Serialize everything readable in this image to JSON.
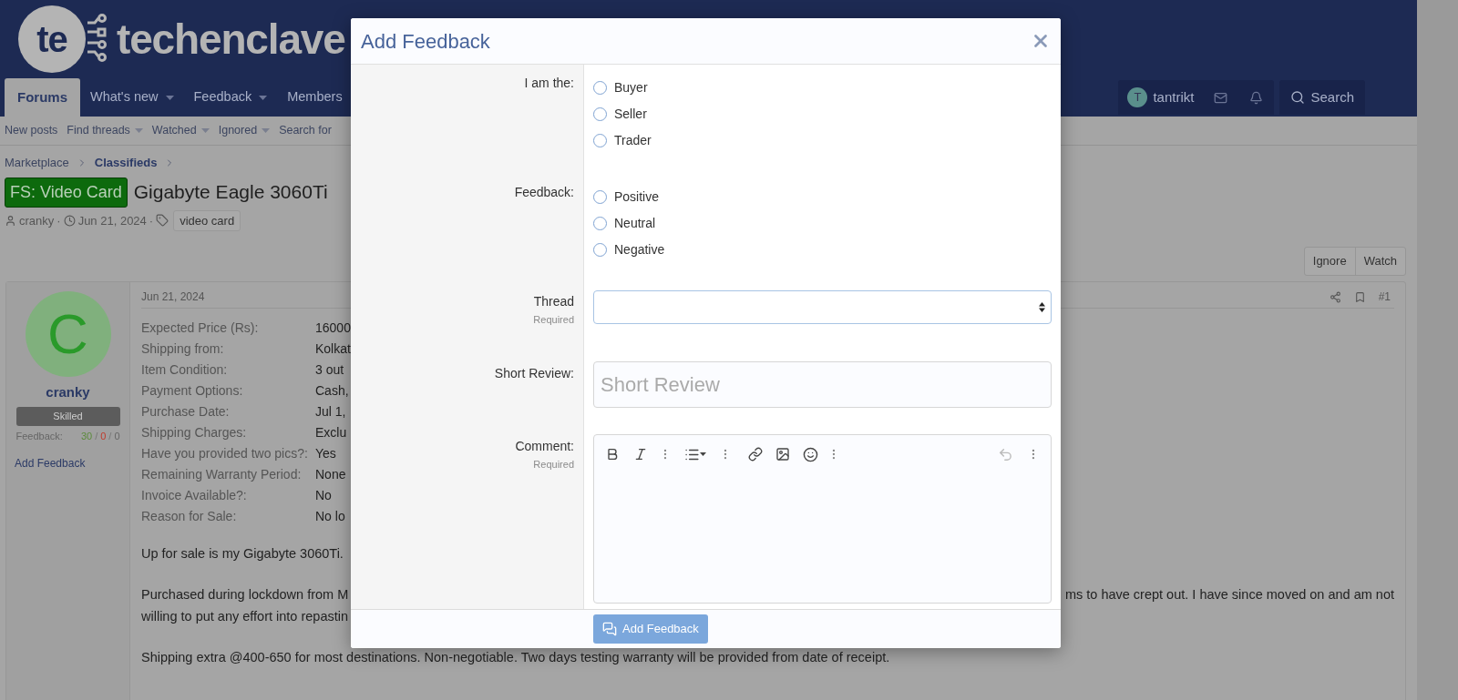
{
  "header": {
    "logo_badge": "te",
    "logo_wordmark": "techenclave",
    "nav_tabs": [
      {
        "label": "Forums",
        "selected": true,
        "has_menu": false
      },
      {
        "label": "What's new",
        "selected": false,
        "has_menu": true
      },
      {
        "label": "Feedback",
        "selected": false,
        "has_menu": true
      },
      {
        "label": "Members",
        "selected": false,
        "has_menu": false
      }
    ],
    "user": {
      "initial": "T",
      "name": "tantrikt"
    },
    "search": "Search"
  },
  "sub_nav": [
    {
      "label": "New posts",
      "has_menu": false
    },
    {
      "label": "Find threads",
      "has_menu": true
    },
    {
      "label": "Watched",
      "has_menu": true
    },
    {
      "label": "Ignored",
      "has_menu": true
    },
    {
      "label": "Search for",
      "has_menu": false
    }
  ],
  "breadcrumb": [
    {
      "label": "Marketplace",
      "current": false
    },
    {
      "label": "Classifieds",
      "current": true
    }
  ],
  "thread": {
    "prefix": "FS: Video Card",
    "title": "Gigabyte Eagle 3060Ti",
    "author": "cranky",
    "separator": "·",
    "date": "Jun 21, 2024",
    "tags": [
      "video card"
    ]
  },
  "actions": [
    "Ignore",
    "Watch"
  ],
  "post": {
    "user": {
      "initial": "C",
      "name": "cranky",
      "rank": "Skilled",
      "feedback_label": "Feedback:",
      "positive": "30",
      "separator": "/",
      "negative": "0",
      "neutral": "0",
      "add_feedback": "Add Feedback"
    },
    "date": "Jun 21, 2024",
    "number": "#1",
    "fields": [
      {
        "label": "Expected Price (Rs):",
        "value": "16000"
      },
      {
        "label": "Shipping from:",
        "value": "Kolkat"
      },
      {
        "label": "Item Condition:",
        "value": "3 out"
      },
      {
        "label": "Payment Options:",
        "value": "Cash,"
      },
      {
        "label": "Purchase Date:",
        "value": "Jul 1,"
      },
      {
        "label": "Shipping Charges:",
        "value": "Exclu"
      },
      {
        "label": "Have you provided two pics?:",
        "value": "Yes"
      },
      {
        "label": "Remaining Warranty Period:",
        "value": "None"
      },
      {
        "label": "Invoice Available?:",
        "value": "No"
      },
      {
        "label": "Reason for Sale:",
        "value": "No lo"
      }
    ],
    "paragraphs": [
      {
        "lines": [
          {
            "left": "Up for sale is my Gigabyte 3060Ti."
          }
        ]
      },
      {
        "lines": [
          {
            "left": "Purchased during lockdown from M",
            "right": "ms to have crept out. I have since moved on and am not"
          },
          {
            "left": "willing to put any effort into repastin"
          }
        ]
      },
      {
        "lines": [
          {
            "left": "Shipping extra @400-650 for most destinations. Non-negotiable. Two days testing warranty will be provided from date of receipt."
          }
        ]
      }
    ]
  },
  "modal": {
    "title": "Add Feedback",
    "fields": [
      {
        "kind": "radio",
        "label": "I am the:",
        "options": [
          {
            "label": "Buyer",
            "selected": false
          },
          {
            "label": "Seller",
            "selected": false
          },
          {
            "label": "Trader",
            "selected": false
          }
        ]
      },
      {
        "kind": "radio",
        "label": "Feedback:",
        "options": [
          {
            "label": "Positive",
            "selected": false
          },
          {
            "label": "Neutral",
            "selected": false
          },
          {
            "label": "Negative",
            "selected": false
          }
        ]
      },
      {
        "kind": "select",
        "label": "Thread",
        "hint": "Required"
      },
      {
        "kind": "text",
        "label": "Short Review:",
        "placeholder": "Short Review"
      },
      {
        "kind": "editor",
        "label": "Comment:",
        "hint": "Required"
      }
    ],
    "submit": "Add Feedback"
  }
}
